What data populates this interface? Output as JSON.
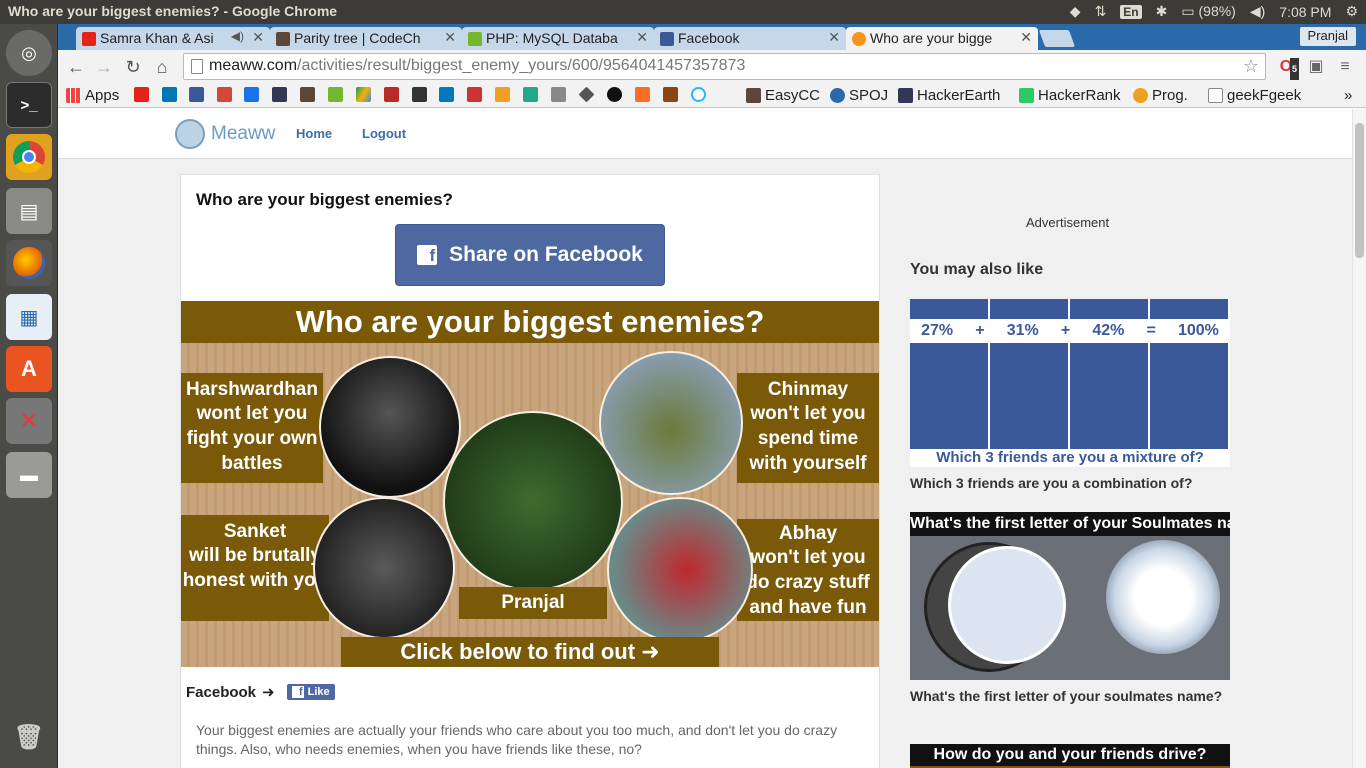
{
  "os": {
    "window_title": "Who are your biggest enemies? - Google Chrome",
    "keyboard": "En",
    "battery": "(98%)",
    "clock": "7:08 PM"
  },
  "browser": {
    "tabs": [
      {
        "label": "Samra Khan & Asi",
        "favicon_color": "#e62117"
      },
      {
        "label": "Parity tree | CodeCh",
        "favicon_color": "#5b4638"
      },
      {
        "label": "PHP: MySQL Databa",
        "favicon_color": "#74b72e"
      },
      {
        "label": "Facebook",
        "favicon_color": "#3b5998"
      },
      {
        "label": "Who are your bigge",
        "favicon_color": "#f7941d"
      }
    ],
    "profile": "Pranjal",
    "url_host": "meaww.com",
    "url_path": "/activities/result/biggest_enemy_yours/600/9564041457357873",
    "extension_badge": "5",
    "bookmarks": [
      {
        "label": "Apps"
      },
      {
        "label": "EasyCC"
      },
      {
        "label": "SPOJ"
      },
      {
        "label": "HackerEarth"
      },
      {
        "label": "HackerRank"
      },
      {
        "label": "Prog."
      },
      {
        "label": "geekFgeek"
      }
    ]
  },
  "site": {
    "logo": "Meaww",
    "nav": [
      "Home",
      "Logout"
    ]
  },
  "quiz": {
    "title": "Who are your biggest enemies?",
    "share_label": "Share on Facebook",
    "image": {
      "heading": "Who are your biggest enemies?",
      "cta": "Click below to find out",
      "friends": [
        {
          "name": "Harshwardhan",
          "text": "wont let you fight your own battles"
        },
        {
          "name": "Chinmay",
          "text": "won't let you spend time with yourself"
        },
        {
          "name": "Sanket",
          "text": "will be brutally honest with you"
        },
        {
          "name": "Pranjal",
          "text": ""
        },
        {
          "name": "Abhay",
          "text": "won't let you do crazy stuff and have fun"
        }
      ]
    },
    "facebook_label": "Facebook",
    "like_label": "Like",
    "description": "Your biggest enemies are actually your friends who care about you too much, and don't let you do crazy things. Also, who needs enemies, when you have friends like these, no?"
  },
  "sidebar": {
    "ad_label": "Advertisement",
    "also_title": "You may also like",
    "items": [
      {
        "thumb_percents": [
          "27%",
          "+",
          "31%",
          "+",
          "42%",
          "=",
          "100%"
        ],
        "thumb_text": "Which 3 friends are you a mixture of?",
        "caption": "Which 3 friends are you a combination of?"
      },
      {
        "thumb_text": "What's the first letter of your Soulmates name?",
        "caption": "What's the first letter of your soulmates name?"
      },
      {
        "thumb_text": "How do you and your friends drive?",
        "caption": ""
      }
    ]
  }
}
